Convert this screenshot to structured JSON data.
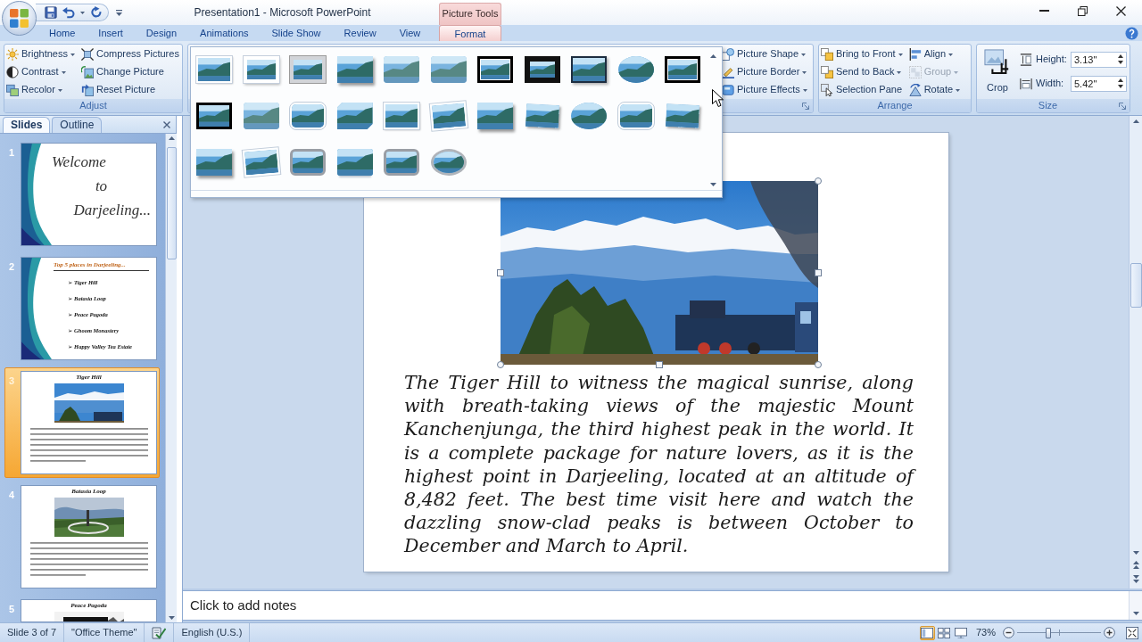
{
  "window": {
    "title": "Presentation1 - Microsoft PowerPoint"
  },
  "tabs": [
    {
      "label": "Home",
      "selected": false
    },
    {
      "label": "Insert",
      "selected": false
    },
    {
      "label": "Design",
      "selected": false
    },
    {
      "label": "Animations",
      "selected": false
    },
    {
      "label": "Slide Show",
      "selected": false
    },
    {
      "label": "Review",
      "selected": false
    },
    {
      "label": "View",
      "selected": false
    }
  ],
  "contextual_tabs": {
    "group_label": "Picture Tools",
    "tabs": [
      {
        "label": "Format",
        "selected": true
      }
    ]
  },
  "ribbon": {
    "adjust": {
      "label": "Adjust",
      "columns": [
        [
          {
            "label": "Brightness",
            "dropdown": true
          },
          {
            "label": "Contrast",
            "dropdown": true
          },
          {
            "label": "Recolor",
            "dropdown": true
          }
        ],
        [
          {
            "label": "Compress Pictures",
            "dropdown": false
          },
          {
            "label": "Change Picture",
            "dropdown": false
          },
          {
            "label": "Reset Picture",
            "dropdown": false
          }
        ]
      ]
    },
    "picture_styles": {
      "gallery": [
        {
          "kind": "white-frame"
        },
        {
          "kind": "thick-white-frame"
        },
        {
          "kind": "grey-frame"
        },
        {
          "kind": "drop-shadow"
        },
        {
          "kind": "soft-edge"
        },
        {
          "kind": "soft-edge"
        },
        {
          "kind": "double-black-frame"
        },
        {
          "kind": "black-matte"
        },
        {
          "kind": "dark-border"
        },
        {
          "kind": "oval"
        },
        {
          "kind": "double-black-frame"
        },
        {
          "kind": "black-frame"
        },
        {
          "kind": "soft-edge"
        },
        {
          "kind": "rounded"
        },
        {
          "kind": "snipped-corner"
        },
        {
          "kind": "white-frame"
        },
        {
          "kind": "tilted"
        },
        {
          "kind": "drop-shadow"
        },
        {
          "kind": "perspective"
        },
        {
          "kind": "oval"
        },
        {
          "kind": "rounded"
        },
        {
          "kind": "perspective"
        },
        {
          "kind": "drop-shadow"
        },
        {
          "kind": "tilted"
        },
        {
          "kind": "metal-rounded"
        },
        {
          "kind": "reflected"
        },
        {
          "kind": "metal-rounded"
        },
        {
          "kind": "metal-oval"
        }
      ],
      "commands": [
        {
          "label": "Picture Shape",
          "dropdown": true
        },
        {
          "label": "Picture Border",
          "dropdown": true
        },
        {
          "label": "Picture Effects",
          "dropdown": true
        }
      ]
    },
    "arrange": {
      "label": "Arrange",
      "columns": [
        [
          {
            "label": "Bring to Front",
            "dropdown": true,
            "disabled": false
          },
          {
            "label": "Send to Back",
            "dropdown": true,
            "disabled": false
          },
          {
            "label": "Selection Pane",
            "dropdown": false,
            "disabled": false
          }
        ],
        [
          {
            "label": "Align",
            "dropdown": true,
            "disabled": false
          },
          {
            "label": "Group",
            "dropdown": true,
            "disabled": true
          },
          {
            "label": "Rotate",
            "dropdown": true,
            "disabled": false
          }
        ]
      ]
    },
    "size": {
      "label": "Size",
      "crop": {
        "label": "Crop"
      },
      "fields": [
        {
          "label": "Height:",
          "value": "3.13\""
        },
        {
          "label": "Width:",
          "value": "5.42\""
        }
      ]
    }
  },
  "slides_panel": {
    "tabs": [
      {
        "label": "Slides",
        "selected": true
      },
      {
        "label": "Outline",
        "selected": false
      }
    ],
    "slides": [
      {
        "number": "1",
        "selected": false,
        "kind": "title",
        "lines": [
          "Welcome",
          "to",
          "Darjeeling..."
        ]
      },
      {
        "number": "2",
        "selected": false,
        "kind": "bullets",
        "title": "Top 5 places in Darjeeling...",
        "bullets": [
          "➢ Tiger Hill",
          "➢ Batasia Loop",
          "➢ Peace Pagoda",
          "➢ Ghoom Monastery",
          "➢ Happy Valley Tea Estate"
        ]
      },
      {
        "number": "3",
        "selected": true,
        "kind": "picture",
        "title": "Tiger Hill",
        "body_text": true
      },
      {
        "number": "4",
        "selected": false,
        "kind": "picture",
        "title": "Batasia Loop",
        "body_text": true
      },
      {
        "number": "5",
        "selected": false,
        "kind": "picture",
        "title": "Peace Pagoda",
        "body_text": false
      }
    ]
  },
  "slide": {
    "paragraph": "The Tiger Hill to witness the magical sunrise, along with breath-taking views of the majestic Mount Kanchenjunga, the third highest peak in the world. It is a complete package for nature lovers, as it is the highest point in Darjeeling, located at an altitude of 8,482 feet. The best time visit here and watch the dazzling snow-clad peaks is between October to December and March to April."
  },
  "notes": {
    "placeholder": "Click to add notes"
  },
  "status_bar": {
    "slide_position": "Slide 3 of 7",
    "theme": "\"Office Theme\"",
    "language": "English (U.S.)",
    "views": [
      {
        "selected": true
      },
      {
        "selected": false
      },
      {
        "selected": false
      }
    ],
    "zoom": "73%",
    "zoom_slider": {
      "level": 0.37
    }
  }
}
